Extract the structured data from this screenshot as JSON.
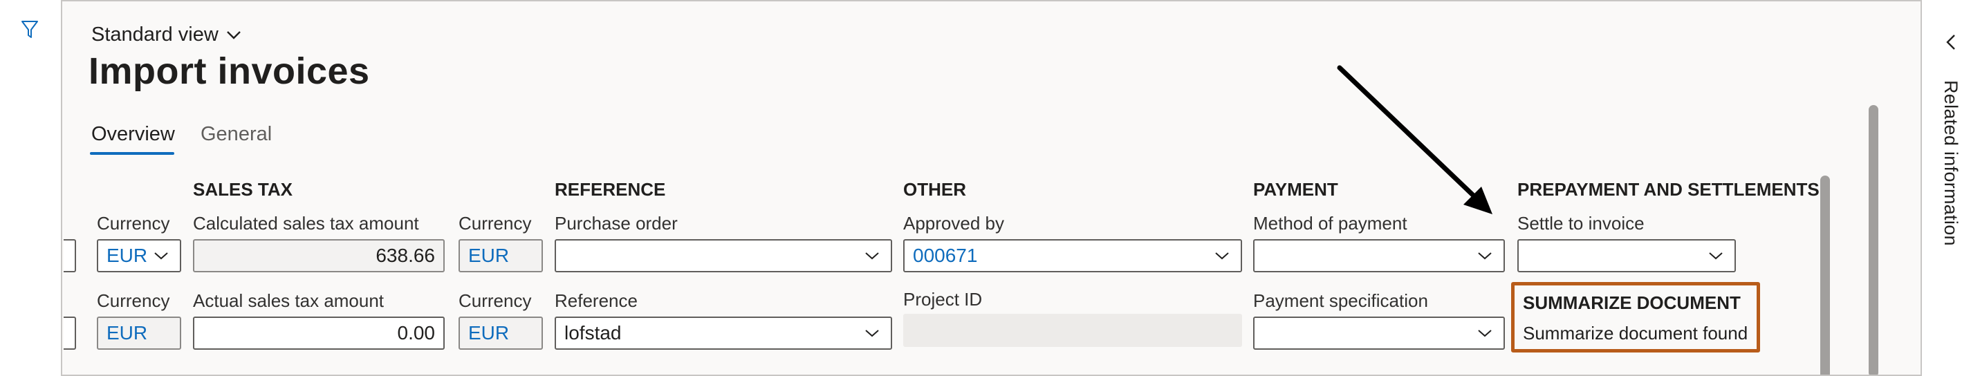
{
  "left_rail": {
    "filter_icon": "filter-icon"
  },
  "header": {
    "view_label": "Standard view",
    "title": "Import invoices"
  },
  "tabs": [
    {
      "label": "Overview",
      "active": true
    },
    {
      "label": "General",
      "active": false
    }
  ],
  "sections": {
    "sales_tax": "SALES TAX",
    "reference": "REFERENCE",
    "other": "OTHER",
    "payment": "PAYMENT",
    "prepayment": "PREPAYMENT AND SETTLEMENTS"
  },
  "row1": {
    "currency_label": "Currency",
    "currency_value": "EUR",
    "calc_tax_label": "Calculated sales tax amount",
    "calc_tax_value": "638.66",
    "currency2_label": "Currency",
    "currency2_value": "EUR",
    "purchase_order_label": "Purchase order",
    "purchase_order_value": "",
    "approved_by_label": "Approved by",
    "approved_by_value": "000671",
    "method_of_payment_label": "Method of payment",
    "method_of_payment_value": "",
    "settle_to_invoice_label": "Settle to invoice",
    "settle_to_invoice_value": ""
  },
  "row2": {
    "currency_label": "Currency",
    "currency_value": "EUR",
    "actual_tax_label": "Actual sales tax amount",
    "actual_tax_value": "0.00",
    "currency2_label": "Currency",
    "currency2_value": "EUR",
    "reference_label": "Reference",
    "reference_value": "lofstad",
    "project_id_label": "Project ID",
    "project_id_value": "",
    "payment_spec_label": "Payment specification",
    "payment_spec_value": ""
  },
  "summarize": {
    "title": "SUMMARIZE DOCUMENT",
    "text": "Summarize document found"
  },
  "right_rail": {
    "label": "Related information"
  },
  "colors": {
    "accent": "#0f6cbd",
    "highlight_border": "#b85c1a",
    "annotation_arrow": "#000000"
  }
}
